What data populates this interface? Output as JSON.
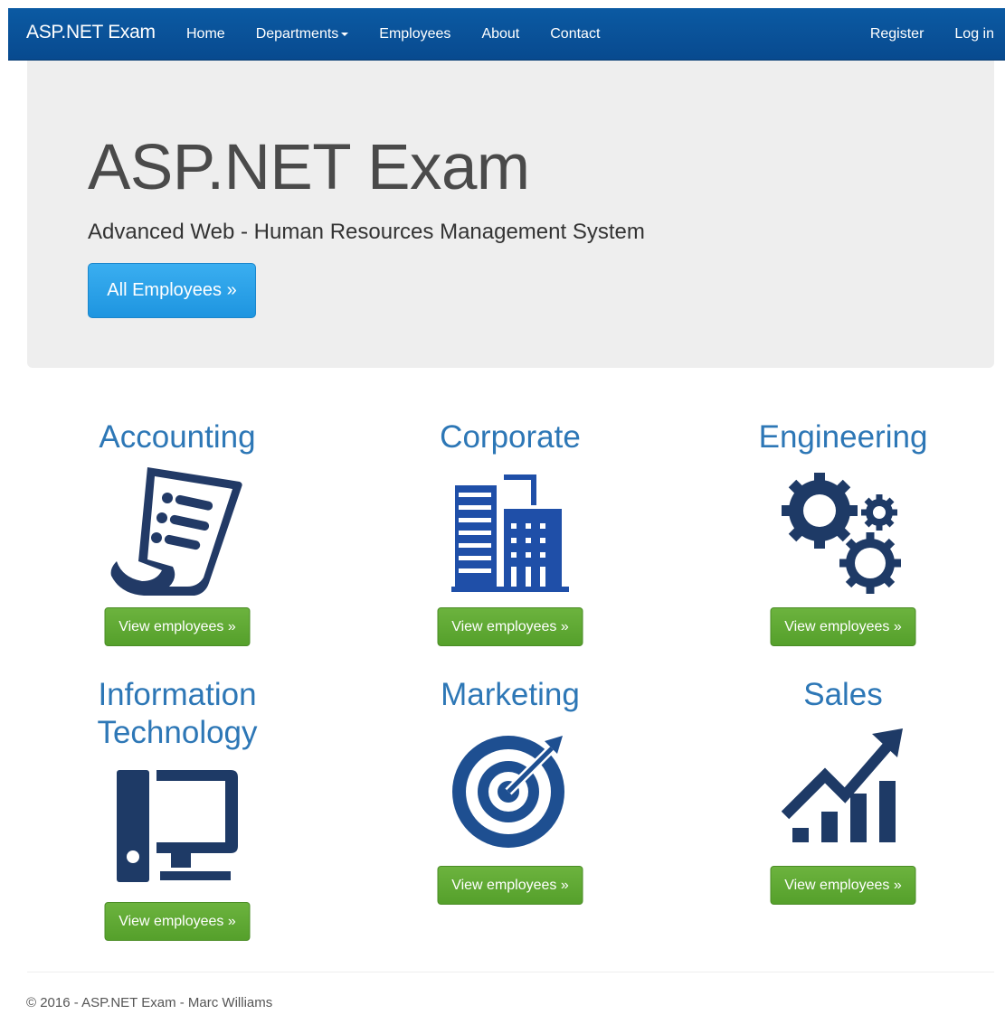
{
  "navbar": {
    "brand": "ASP.NET Exam",
    "links": [
      "Home",
      "Departments",
      "Employees",
      "About",
      "Contact"
    ],
    "right_links": [
      "Register",
      "Log in"
    ]
  },
  "jumbotron": {
    "title": "ASP.NET Exam",
    "lead": "Advanced Web - Human Resources Management System",
    "button": "All Employees »"
  },
  "departments": [
    {
      "name": "Accounting",
      "icon": "invoice-icon",
      "button": "View employees »"
    },
    {
      "name": "Corporate",
      "icon": "building-icon",
      "button": "View employees »"
    },
    {
      "name": "Engineering",
      "icon": "gears-icon",
      "button": "View employees »"
    },
    {
      "name_line1": "Information",
      "name_line2": "Technology",
      "icon": "computer-icon",
      "button": "View employees »"
    },
    {
      "name": "Marketing",
      "icon": "target-icon",
      "button": "View employees »"
    },
    {
      "name": "Sales",
      "icon": "growth-chart-icon",
      "button": "View employees »"
    }
  ],
  "footer": {
    "text": "© 2016 - ASP.NET Exam - Marc Williams"
  },
  "colors": {
    "navbar": "#0b5aa3",
    "jumbotron_bg": "#eeeeee",
    "primary_button": "#2aa3ea",
    "success_button": "#5fa834",
    "department_title": "#2d77b6",
    "icon_dark": "#1e3f73"
  }
}
